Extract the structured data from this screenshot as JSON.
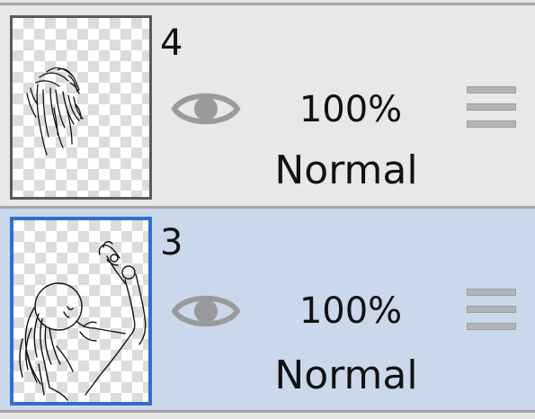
{
  "layers": [
    {
      "number": "4",
      "opacity": "100%",
      "blend_mode": "Normal",
      "visible": true,
      "selected": false,
      "thumbnail_icon": "hair-sketch",
      "eye_icon": "eye-icon",
      "handle_icon": "drag-handle-icon"
    },
    {
      "number": "3",
      "opacity": "100%",
      "blend_mode": "Normal",
      "visible": true,
      "selected": true,
      "thumbnail_icon": "figure-sketch",
      "eye_icon": "eye-icon",
      "handle_icon": "drag-handle-icon"
    }
  ],
  "colors": {
    "selected_row_bg": "#cbd8ec",
    "row_bg": "#e8e8e8",
    "selected_border": "#2f6fd0",
    "eye": "#9a9a9a"
  }
}
